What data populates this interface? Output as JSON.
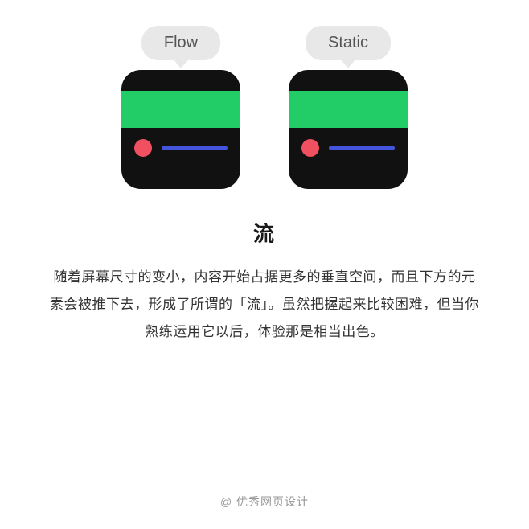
{
  "header": {
    "flow_label": "Flow",
    "static_label": "Static"
  },
  "content": {
    "title": "流",
    "description": "随着屏幕尺寸的变小，内容开始占据更多的垂直空间，而且下方的元素会被推下去，形成了所谓的「流」。虽然把握起来比较困难，但当你熟练运用它以后，体验那是相当出色。",
    "footer": "@ 优秀网页设计"
  },
  "colors": {
    "black_box": "#111111",
    "green_bar": "#22cc66",
    "pink_dot": "#f05060",
    "blue_line": "#4455dd",
    "bubble_bg": "#e8e8e8"
  }
}
